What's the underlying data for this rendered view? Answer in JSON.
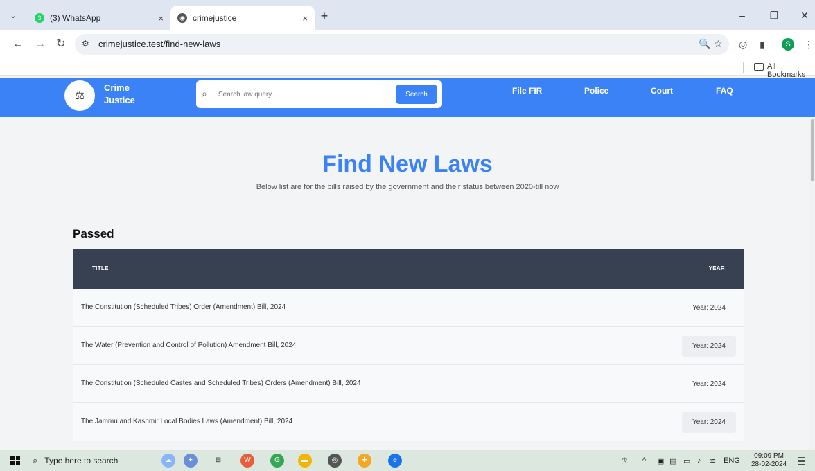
{
  "browser": {
    "tabs": [
      {
        "title": "(3) WhatsApp",
        "badge": "3",
        "active": false
      },
      {
        "title": "crimejustice",
        "active": true
      }
    ],
    "url": "crimejustice.test/find-new-laws",
    "bookmarks_label": "All Bookmarks",
    "profile_initial": "S"
  },
  "site": {
    "brand": {
      "line1": "Crime",
      "line2": "Justice"
    },
    "search": {
      "placeholder": "Search law query...",
      "button": "Search"
    },
    "nav": [
      "File FIR",
      "Police",
      "Court",
      "FAQ"
    ]
  },
  "page": {
    "title": "Find New Laws",
    "subtitle": "Below list are for the bills raised by the government and their status between 2020-till now",
    "section": "Passed",
    "table": {
      "headers": {
        "title": "TITLE",
        "year": "YEAR"
      },
      "rows": [
        {
          "title": "The Constitution (Scheduled Tribes) Order (Amendment) Bill, 2024",
          "year": "Year: 2024"
        },
        {
          "title": "The Water (Prevention and Control of Pollution) Amendment Bill, 2024",
          "year": "Year: 2024"
        },
        {
          "title": "The Constitution (Scheduled Castes and Scheduled Tribes) Orders (Amendment) Bill, 2024",
          "year": "Year: 2024"
        },
        {
          "title": "The Jammu and Kashmir Local Bodies Laws (Amendment) Bill, 2024",
          "year": "Year: 2024"
        }
      ]
    }
  },
  "taskbar": {
    "search_text": "Type here to search",
    "language": "ENG",
    "time": "09:09 PM",
    "date": "28-02-2024"
  }
}
